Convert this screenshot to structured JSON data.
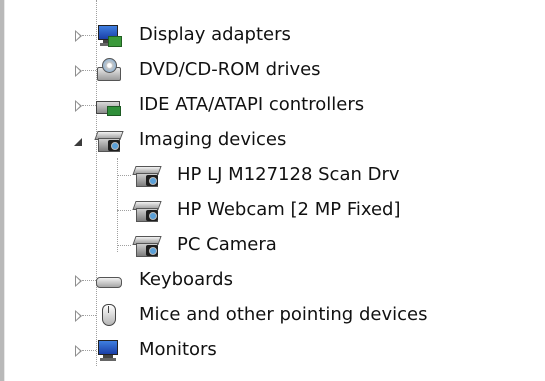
{
  "tree": {
    "items": [
      {
        "label": "Display adapters",
        "state": "collapsed",
        "icon": "display-adapter-icon",
        "level": 0
      },
      {
        "label": "DVD/CD-ROM drives",
        "state": "collapsed",
        "icon": "dvd-drive-icon",
        "level": 0
      },
      {
        "label": "IDE ATA/ATAPI controllers",
        "state": "collapsed",
        "icon": "ide-controller-icon",
        "level": 0
      },
      {
        "label": "Imaging devices",
        "state": "expanded",
        "icon": "imaging-device-icon",
        "level": 0
      },
      {
        "label": "HP LJ M127128 Scan Drv",
        "state": "leaf",
        "icon": "imaging-device-icon",
        "level": 1
      },
      {
        "label": "HP Webcam [2 MP Fixed]",
        "state": "leaf",
        "icon": "imaging-device-icon",
        "level": 1
      },
      {
        "label": "PC Camera",
        "state": "leaf",
        "icon": "imaging-device-icon",
        "level": 1
      },
      {
        "label": "Keyboards",
        "state": "collapsed",
        "icon": "keyboard-icon",
        "level": 0
      },
      {
        "label": "Mice and other pointing devices",
        "state": "collapsed",
        "icon": "mouse-icon",
        "level": 0
      },
      {
        "label": "Monitors",
        "state": "collapsed",
        "icon": "monitor-icon",
        "level": 0
      }
    ]
  }
}
